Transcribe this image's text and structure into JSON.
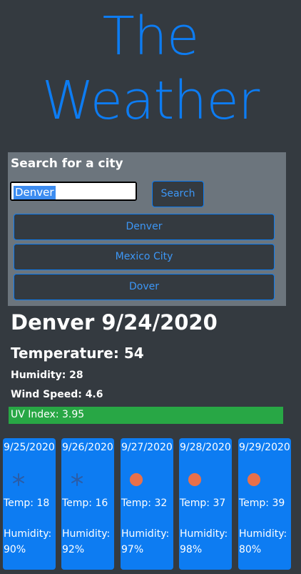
{
  "app": {
    "title_line1": "The",
    "title_line2": "Weather"
  },
  "search": {
    "heading": "Search for a city",
    "input_value": "Denver",
    "button_label": "Search"
  },
  "history": [
    "Denver",
    "Mexico City",
    "Dover"
  ],
  "current": {
    "city_date": "Denver 9/24/2020",
    "temperature": "Temperature: 54",
    "humidity": "Humidity: 28",
    "wind": "Wind Speed: 4.6",
    "uv": "UV Index: 3.95",
    "uv_color": "#28a745"
  },
  "forecast": [
    {
      "date": "9/25/2020",
      "icon": "snowflake-icon",
      "temp": "Temp: 18",
      "humidity": "Humidity: 90%"
    },
    {
      "date": "9/26/2020",
      "icon": "snowflake-icon",
      "temp": "Temp: 16",
      "humidity": "Humidity: 92%"
    },
    {
      "date": "9/27/2020",
      "icon": "sun-icon",
      "temp": "Temp: 32",
      "humidity": "Humidity: 97%"
    },
    {
      "date": "9/28/2020",
      "icon": "sun-icon",
      "temp": "Temp: 37",
      "humidity": "Humidity: 98%"
    },
    {
      "date": "9/29/2020",
      "icon": "sun-icon",
      "temp": "Temp: 39",
      "humidity": "Humidity: 80%"
    }
  ],
  "colors": {
    "accent": "#0d7cf2",
    "background": "#343a40",
    "panel": "#6c757d",
    "sun": "#e8704a",
    "snowflake": "#2a5da8"
  }
}
